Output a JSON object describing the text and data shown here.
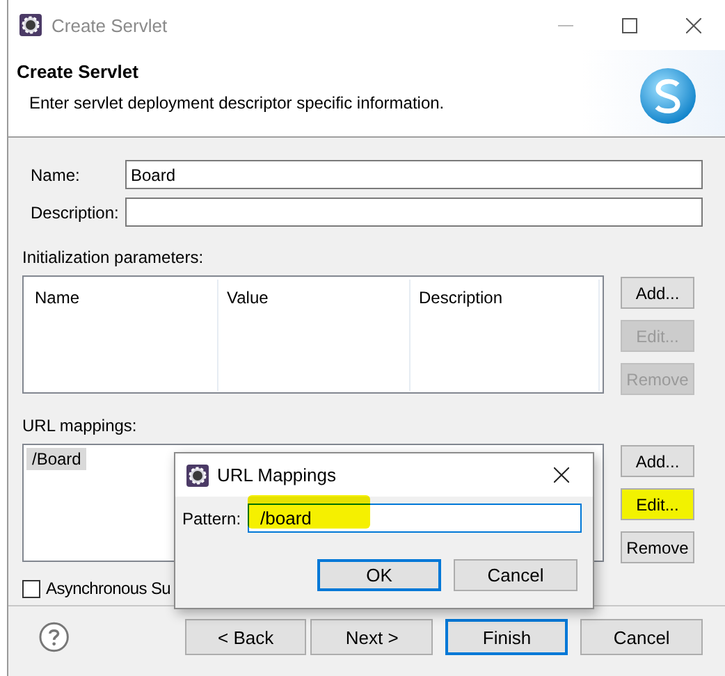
{
  "window": {
    "title": "Create Servlet"
  },
  "header": {
    "title": "Create Servlet",
    "description": "Enter servlet deployment descriptor specific information."
  },
  "fields": [
    {
      "label": "Name:",
      "value": "Board"
    },
    {
      "label": "Description:"
    }
  ],
  "init_parameters": {
    "label": "Initialization parameters:",
    "columns": [
      "Name",
      "Value",
      "Description"
    ],
    "buttons": [
      {
        "label": "Add...",
        "disabled": false,
        "highlighted": false
      },
      {
        "label": "Edit...",
        "disabled": true,
        "highlighted": false
      },
      {
        "label": "Remove",
        "disabled": true,
        "highlighted": false
      }
    ]
  },
  "url_mappings": {
    "label": "URL mappings:",
    "items": [
      {
        "text": "/Board",
        "selected": true
      }
    ],
    "buttons": [
      {
        "label": "Add...",
        "disabled": false,
        "highlighted": false
      },
      {
        "label": "Edit...",
        "disabled": false,
        "highlighted": true
      },
      {
        "label": "Remove",
        "disabled": false,
        "highlighted": false
      }
    ]
  },
  "async_checkbox": {
    "label": "Asynchronous Su",
    "checked": false
  },
  "footer_buttons": [
    {
      "label": "< Back",
      "default": false
    },
    {
      "label": "Next >",
      "default": false
    },
    {
      "label": "Finish",
      "default": true
    },
    {
      "label": "Cancel",
      "default": false
    }
  ],
  "popup": {
    "title": "URL Mappings",
    "pattern_label": "Pattern:",
    "pattern_value": "/board",
    "highlighted": true,
    "buttons": [
      {
        "label": "OK",
        "default": true
      },
      {
        "label": "Cancel",
        "default": false
      }
    ]
  }
}
